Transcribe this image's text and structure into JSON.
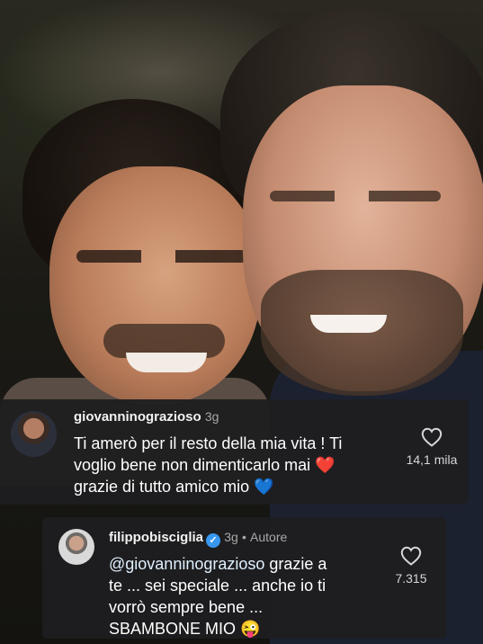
{
  "comments": [
    {
      "username": "giovanninograzioso",
      "time": "3g",
      "text": "Ti amerò per il resto della mia vita ! Ti voglio bene non dimenticarlo mai ❤️ grazie di tutto amico mio 💙",
      "lines": [
        "Ti amerò per il resto della mia vita ! Ti",
        "voglio bene non dimenticarlo mai ❤️",
        "grazie di tutto amico mio 💙"
      ],
      "likes": "14,1 mila"
    },
    {
      "username": "filippobisciglia",
      "time": "3g",
      "separator": "•",
      "role": "Autore",
      "mention": "@giovanninograzioso",
      "lines": [
        " grazie a",
        "te ... sei speciale ... anche io ti",
        "vorrò sempre bene ...",
        "SBAMBONE MIO 😜"
      ],
      "likes": "7.315"
    }
  ],
  "icons": {
    "like": "heart-outline-icon",
    "verified": "verified-badge-icon"
  },
  "colors": {
    "card_bg": "#1e1e20",
    "verified": "#3897f0",
    "text": "#ffffff",
    "meta": "#a8a8a8"
  }
}
